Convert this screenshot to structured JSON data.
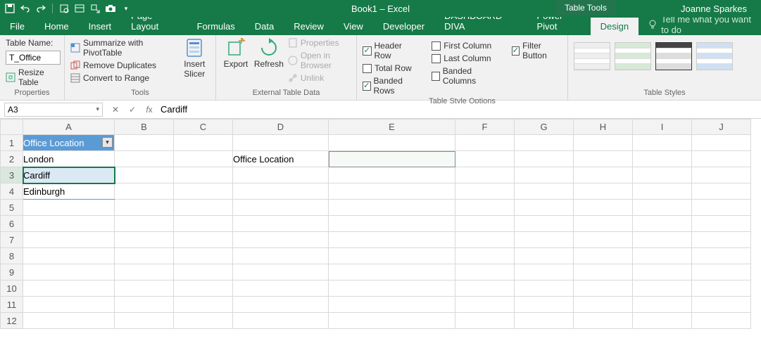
{
  "window": {
    "title": "Book1 – Excel",
    "contextual_tab": "Table Tools",
    "user": "Joanne Sparkes"
  },
  "tabs": {
    "items": [
      "File",
      "Home",
      "Insert",
      "Page Layout",
      "Formulas",
      "Data",
      "Review",
      "View",
      "Developer",
      "DASHBOARD DIVA",
      "Power Pivot"
    ],
    "design": "Design",
    "tellme": "Tell me what you want to do"
  },
  "ribbon": {
    "properties": {
      "label": "Properties",
      "table_name_label": "Table Name:",
      "table_name_value": "T_Office",
      "resize": "Resize Table"
    },
    "tools": {
      "label": "Tools",
      "pivot": "Summarize with PivotTable",
      "dupes": "Remove Duplicates",
      "convert": "Convert to Range",
      "slicer": "Insert Slicer"
    },
    "external": {
      "label": "External Table Data",
      "export": "Export",
      "refresh": "Refresh",
      "props": "Properties",
      "browser": "Open in Browser",
      "unlink": "Unlink"
    },
    "styleopts": {
      "label": "Table Style Options",
      "header_row": "Header Row",
      "total_row": "Total Row",
      "banded_rows": "Banded Rows",
      "first_col": "First Column",
      "last_col": "Last Column",
      "banded_cols": "Banded Columns",
      "filter": "Filter Button"
    },
    "styles": {
      "label": "Table Styles"
    }
  },
  "namebox": {
    "ref": "A3",
    "formula": "Cardiff"
  },
  "columns": [
    "A",
    "B",
    "C",
    "D",
    "E",
    "F",
    "G",
    "H",
    "I",
    "J"
  ],
  "rows": [
    "1",
    "2",
    "3",
    "4",
    "5",
    "6",
    "7",
    "8",
    "9",
    "10",
    "11",
    "12"
  ],
  "sheet": {
    "A1": "Office Location",
    "A2": "London",
    "A3": "Cardiff",
    "A4": "Edinburgh",
    "D2": "Office Location"
  },
  "active_cell": "A3",
  "selected_range": "E2"
}
